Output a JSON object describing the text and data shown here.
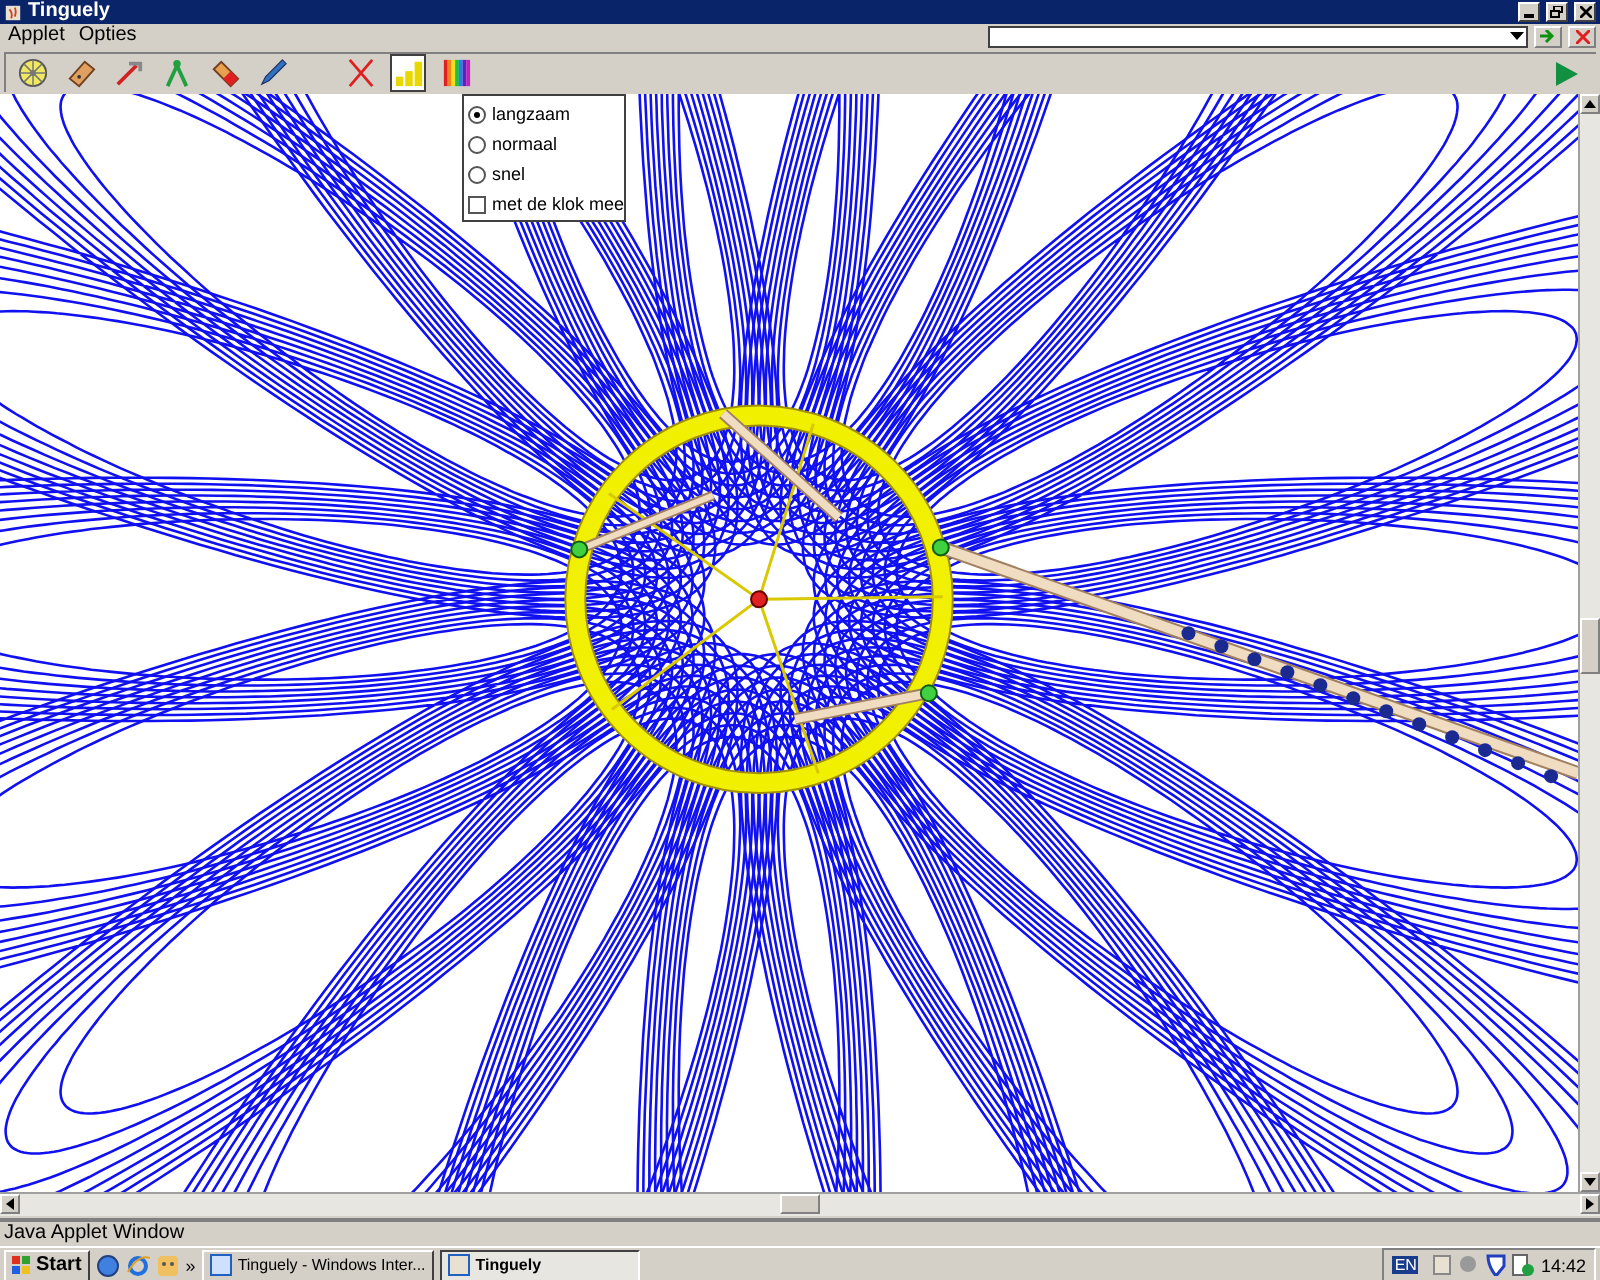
{
  "window": {
    "title": "Tinguely"
  },
  "menu": [
    "Applet",
    "Opties"
  ],
  "toolbar": {
    "groups": [
      [
        {
          "kind": "wheel",
          "selected": false
        },
        {
          "kind": "tag",
          "selected": false
        },
        {
          "kind": "pin",
          "selected": false
        },
        {
          "kind": "compass",
          "selected": false
        },
        {
          "kind": "eraser",
          "selected": false
        },
        {
          "kind": "pencil",
          "selected": false
        }
      ],
      [
        {
          "kind": "delete",
          "selected": false
        },
        {
          "kind": "speed",
          "selected": true
        },
        {
          "kind": "colors",
          "selected": false
        }
      ]
    ]
  },
  "speed_menu": {
    "options": [
      {
        "label": "langzaam",
        "selected": true
      },
      {
        "label": "normaal",
        "selected": false
      },
      {
        "label": "snel",
        "selected": false
      }
    ],
    "clockwise": {
      "label": "met de klok mee",
      "checked": false
    }
  },
  "status_bar": {
    "text": "Java Applet Window"
  },
  "taskbar": {
    "start": "Start",
    "more": "»",
    "tasks": [
      {
        "label": "Tinguely - Windows Inter...",
        "selected": false
      },
      {
        "label": "Tinguely",
        "selected": true
      }
    ],
    "language": "EN",
    "clock": "14:42"
  }
}
